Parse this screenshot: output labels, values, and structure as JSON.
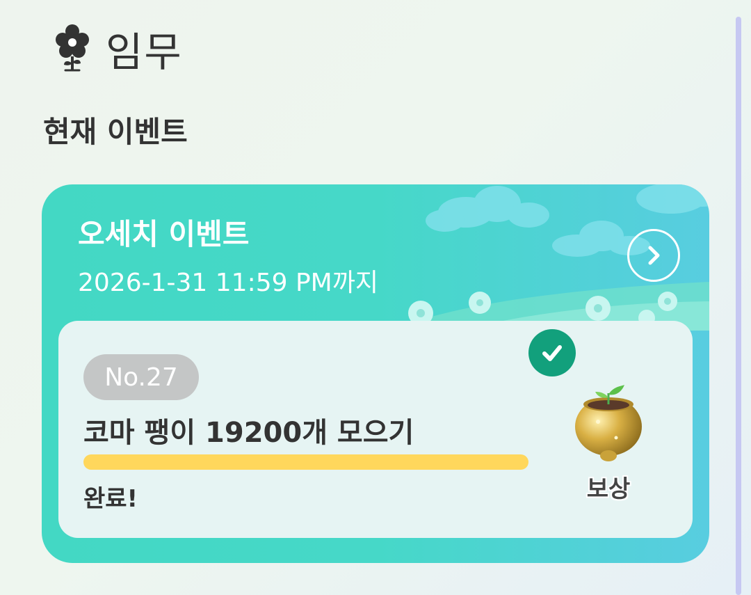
{
  "header": {
    "title": "임무",
    "icon": "flower-icon"
  },
  "section": {
    "title": "현재 이벤트"
  },
  "event": {
    "name": "오세치 이벤트",
    "deadline": "2026-1-31 11:59 PM까지",
    "open_icon": "chevron-right-icon"
  },
  "mission": {
    "number": "No.27",
    "title": "코마 팽이 19200개 모으기",
    "progress": 1.0,
    "status": "완료!",
    "completed_icon": "check-icon",
    "reward_label": "보상",
    "reward_icon": "golden-pot-sprout-icon"
  },
  "colors": {
    "card_gradient_start": "#43d8c4",
    "card_gradient_end": "#58cde0",
    "check_badge": "#12a07c",
    "progress_fill": "#ffd75c",
    "badge_gray": "#c4c6c6"
  }
}
